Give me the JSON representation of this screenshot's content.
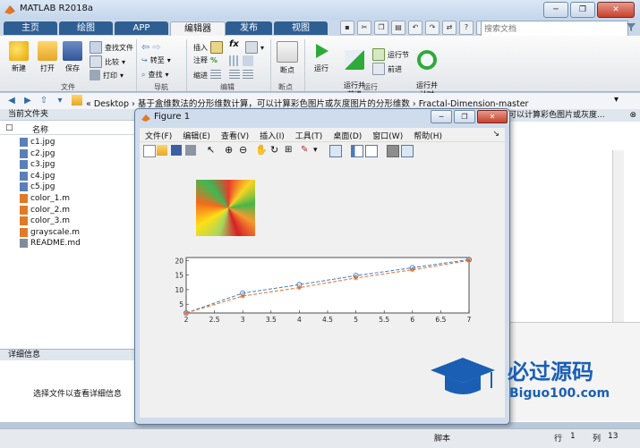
{
  "window": {
    "title": "MATLAB R2018a",
    "controls": [
      "─",
      "❐",
      "✕"
    ]
  },
  "ribbon_tabs": [
    {
      "label": "主页"
    },
    {
      "label": "绘图"
    },
    {
      "label": "APP"
    },
    {
      "label": "编辑器"
    },
    {
      "label": "发布"
    },
    {
      "label": "视图"
    }
  ],
  "search": {
    "placeholder": "搜索文档"
  },
  "ribbon": {
    "file_group": "文件",
    "nav_group": "导航",
    "edit_group": "编辑",
    "breakpoint_group": "断点",
    "run_group": "运行",
    "new": "新建",
    "open": "打开",
    "save": "保存",
    "find_files": "查找文件",
    "compare": "比较",
    "print": "打印",
    "goto": "转至",
    "find": "查找",
    "insert": "插入",
    "fx": "fx",
    "comment": "注释",
    "indent": "缩进",
    "breakpoints": "断点",
    "run": "运行",
    "run_advance": "运行并\n前进",
    "run_section": "运行节",
    "advance": "前进",
    "run_time": "运行并\n计时"
  },
  "address": {
    "path": "« Desktop › 基于盒维数法的分形维数计算，可以计算彩色图片或灰度图片的分形维数 › Fractal-Dimension-master",
    "right_truncated": "可以计算彩色图片或灰度..."
  },
  "current_folder": {
    "title": "当前文件夹",
    "column_name": "名称",
    "files": [
      "c1.jpg",
      "c2.jpg",
      "c3.jpg",
      "c4.jpg",
      "c5.jpg",
      "color_1.m",
      "color_2.m",
      "color_3.m",
      "grayscale.m",
      "README.md"
    ],
    "file_types": [
      "jpg",
      "jpg",
      "jpg",
      "jpg",
      "jpg",
      "m",
      "m",
      "m",
      "m",
      "md"
    ]
  },
  "details": {
    "title": "详细信息",
    "placeholder": "选择文件以查看详细信息"
  },
  "figure": {
    "title": "Figure 1",
    "menu": [
      "文件(F)",
      "编辑(E)",
      "查看(V)",
      "插入(I)",
      "工具(T)",
      "桌面(D)",
      "窗口(W)",
      "帮助(H)"
    ]
  },
  "chart_data": {
    "type": "line",
    "x": [
      2,
      3,
      4,
      5,
      6,
      7
    ],
    "series": [
      {
        "values": [
          2,
          8.8,
          11.7,
          14.8,
          17.5,
          20.3
        ],
        "marker": "o",
        "color": "#3f7fc4"
      },
      {
        "values": [
          2,
          7.8,
          10.7,
          14.0,
          16.8,
          20.0
        ],
        "marker": "*",
        "color": "#e46c2d"
      }
    ],
    "xticks": [
      "2",
      "2.5",
      "3",
      "3.5",
      "4",
      "4.5",
      "5",
      "5.5",
      "6",
      "6.5",
      "7"
    ],
    "yticks": [
      "20",
      "15",
      "10",
      "5"
    ],
    "xlim": [
      2,
      7
    ],
    "ylim": [
      2,
      21
    ]
  },
  "status": {
    "script": "脚本",
    "row_label": "行",
    "row": "1",
    "col_label": "列",
    "col": "13"
  },
  "watermark": {
    "title": "必过源码",
    "url": "Biguo100.com"
  },
  "colors": {
    "ribbon_tab_dark": "#2f5e93",
    "watermark_blue": "#1a5fb4"
  }
}
